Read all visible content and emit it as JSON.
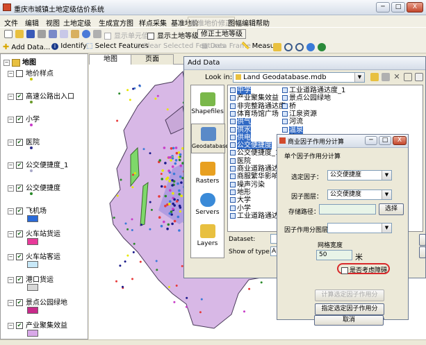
{
  "app": {
    "title": "重庆市城镇土地定级估价系统"
  },
  "window_controls": {
    "minimize": "─",
    "maximize": "□",
    "close": "X"
  },
  "menu": [
    "文件",
    "编辑",
    "视图",
    "土地定级",
    "生成宜方图",
    "样点采集",
    "基准地价",
    "基准地价修正",
    "图幅编辑",
    "帮助"
  ],
  "toolbar1": {
    "buttons": [
      "显示单元值",
      "显示土地等级",
      "修正土地等级"
    ]
  },
  "toolbar2": {
    "add_data": "Add Data...",
    "identify": "Identify",
    "select_features": "Select Features",
    "clear_selected": "Clear Selected Features",
    "data_frame": "Data Frame",
    "measure": "Measure"
  },
  "toc": {
    "root": "地图",
    "layers": [
      {
        "name": "地价样点",
        "checked": false,
        "symbol_color": "#c8c800"
      },
      {
        "name": "高速公路出入口",
        "checked": true,
        "symbol_color": "#6a9a2a"
      },
      {
        "name": "小学",
        "checked": true,
        "symbol_color": "#c83cc8"
      },
      {
        "name": "医院",
        "checked": true,
        "symbol_color": "#2a2a8a"
      },
      {
        "name": "公交便捷度_1",
        "checked": true,
        "symbol_color": "#a8a8c8"
      },
      {
        "name": "公交便捷度",
        "checked": true,
        "symbol_color": "#2a8a2a"
      },
      {
        "name": "飞机场",
        "checked": true,
        "symbol_color": "#2a6ad8"
      },
      {
        "name": "火车站货运",
        "checked": true,
        "symbol_color": "#e83a9a"
      },
      {
        "name": "火车站客运",
        "checked": true,
        "symbol_color": "#c8e8f8"
      },
      {
        "name": "港口货运",
        "checked": true,
        "symbol_color": "#d8d8d8"
      },
      {
        "name": "景点公园绿地",
        "checked": true,
        "symbol_color": "#c82a8a"
      },
      {
        "name": "产业聚集效益",
        "checked": true,
        "symbol_color": "#d8a8e8"
      }
    ]
  },
  "map_tabs": [
    "地图",
    "页面"
  ],
  "add_data": {
    "title": "Add Data",
    "look_in_label": "Look in:",
    "look_in_value": "Land Geodatabase.mdb",
    "places": [
      "Shapefiles",
      "Geodatabases",
      "Rasters",
      "Servers",
      "Layers"
    ],
    "files_col1": [
      "中学",
      "产业聚集效益",
      "非完整路通达度",
      "体育场馆广场",
      "供气",
      "供水",
      "供电",
      "公交便捷度",
      "公交便捷度_1",
      "医院",
      "商业道路通达度",
      "商服繁华影响度",
      "噪声污染",
      "地形",
      "大学",
      "小学",
      "工业道路通达度"
    ],
    "files_col2": [
      "工业道路通达度_1",
      "景点公园绿地",
      "桥",
      "江泉资源",
      "河流",
      "温泉",
      "渡口"
    ],
    "selected_col1": [
      "中学",
      "供气",
      "供水",
      "供电",
      "公交便捷度"
    ],
    "selected_col2": [
      "温泉"
    ],
    "dataset_label": "Dataset:",
    "show_type_label": "Show of type:",
    "show_type_value": "Al"
  },
  "factor_dialog": {
    "title": "商业因子作用分计算",
    "group_label": "单个因子作用分计算",
    "select_factor_label": "选定因子：",
    "select_factor_value": "公交便捷度",
    "factor_layer_label": "因子图层：",
    "factor_layer_value": "公交便捷度",
    "save_path_label": "存储路径：",
    "browse_button": "选择",
    "output_layer_label": "因子作用分图层：",
    "output_layer_value": "",
    "grid_label": "网格宽度",
    "grid_value": "50",
    "grid_unit": "米",
    "consider_obstacle": "是否考虑障碍",
    "calc_selected_button": "计算选定因子作用分",
    "specify_button": "指定选定因子作用分",
    "cancel_button": "取消"
  }
}
